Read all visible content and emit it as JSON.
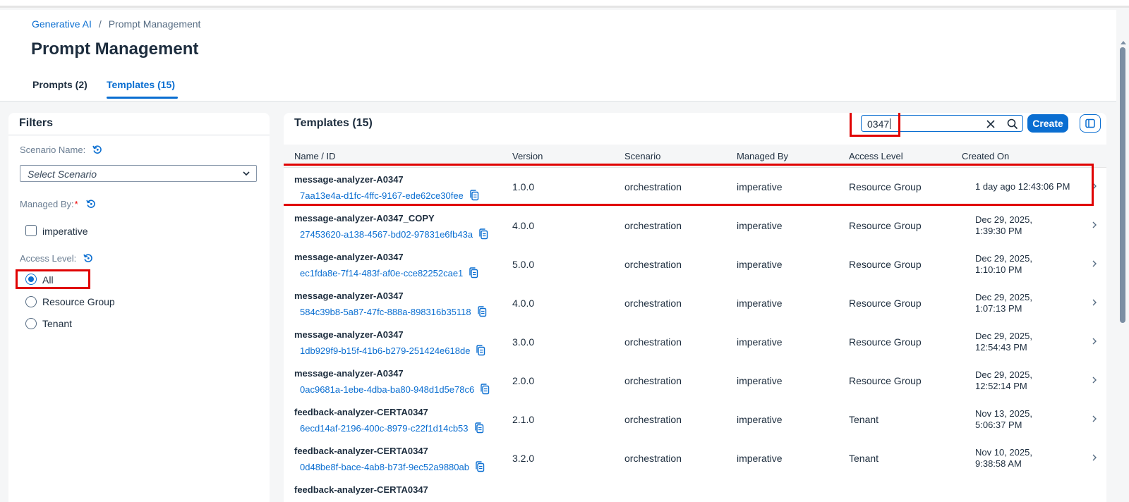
{
  "breadcrumb": {
    "root": "Generative AI",
    "separator": "/",
    "current": "Prompt Management"
  },
  "page_title": "Prompt Management",
  "tabs": [
    {
      "label": "Prompts (2)",
      "active": false
    },
    {
      "label": "Templates (15)",
      "active": true
    }
  ],
  "filters": {
    "title": "Filters",
    "scenario_label": "Scenario Name:",
    "scenario_placeholder": "Select Scenario",
    "managed_label": "Managed By:",
    "managed_required": "*",
    "managed_option": "imperative",
    "access_label": "Access Level:",
    "access_options": [
      "All",
      "Resource Group",
      "Tenant"
    ],
    "access_selected": "All"
  },
  "templates": {
    "title": "Templates (15)",
    "search_value": "0347",
    "create_label": "Create",
    "columns": [
      "Name / ID",
      "Version",
      "Scenario",
      "Managed By",
      "Access Level",
      "Created On"
    ],
    "rows": [
      {
        "name": "message-analyzer-A0347",
        "id": "7aa13e4a-d1fc-4ffc-9167-ede62ce30fee",
        "version": "1.0.0",
        "scenario": "orchestration",
        "managed_by": "imperative",
        "access": "Resource Group",
        "created_1": "1 day ago 12:43:06 PM",
        "created_2": ""
      },
      {
        "name": "message-analyzer-A0347_COPY",
        "id": "27453620-a138-4567-bd02-97831e6fb43a",
        "version": "4.0.0",
        "scenario": "orchestration",
        "managed_by": "imperative",
        "access": "Resource Group",
        "created_1": "Dec 29, 2025,",
        "created_2": "1:39:30 PM"
      },
      {
        "name": "message-analyzer-A0347",
        "id": "ec1fda8e-7f14-483f-af0e-cce82252cae1",
        "version": "5.0.0",
        "scenario": "orchestration",
        "managed_by": "imperative",
        "access": "Resource Group",
        "created_1": "Dec 29, 2025,",
        "created_2": "1:10:10 PM"
      },
      {
        "name": "message-analyzer-A0347",
        "id": "584c39b8-5a87-47fc-888a-898316b35118",
        "version": "4.0.0",
        "scenario": "orchestration",
        "managed_by": "imperative",
        "access": "Resource Group",
        "created_1": "Dec 29, 2025,",
        "created_2": "1:07:13 PM"
      },
      {
        "name": "message-analyzer-A0347",
        "id": "1db929f9-b15f-41b6-b279-251424e618de",
        "version": "3.0.0",
        "scenario": "orchestration",
        "managed_by": "imperative",
        "access": "Resource Group",
        "created_1": "Dec 29, 2025,",
        "created_2": "12:54:43 PM"
      },
      {
        "name": "message-analyzer-A0347",
        "id": "0ac9681a-1ebe-4dba-ba80-948d1d5e78c6",
        "version": "2.0.0",
        "scenario": "orchestration",
        "managed_by": "imperative",
        "access": "Resource Group",
        "created_1": "Dec 29, 2025,",
        "created_2": "12:52:14 PM"
      },
      {
        "name": "feedback-analyzer-CERTA0347",
        "id": "6ecd14af-2196-400c-8979-c22f1d14cb53",
        "version": "2.1.0",
        "scenario": "orchestration",
        "managed_by": "imperative",
        "access": "Tenant",
        "created_1": "Nov 13, 2025,",
        "created_2": "5:06:37 PM"
      },
      {
        "name": "feedback-analyzer-CERTA0347",
        "id": "0d48be8f-bace-4ab8-b73f-9ec52a9880ab",
        "version": "3.2.0",
        "scenario": "orchestration",
        "managed_by": "imperative",
        "access": "Tenant",
        "created_1": "Nov 10, 2025,",
        "created_2": "9:38:58 AM"
      },
      {
        "name": "feedback-analyzer-CERTA0347",
        "id": "",
        "version": "",
        "scenario": "",
        "managed_by": "",
        "access": "",
        "created_1": "",
        "created_2": ""
      }
    ]
  },
  "icons": {
    "reset": "reset-icon",
    "chevron_down": "chevron-down-icon",
    "clear": "close-icon",
    "search": "search-icon",
    "copy": "copy-icon",
    "row_arrow": "chevron-right-icon",
    "panel": "sidebar-toggle-icon"
  },
  "colors": {
    "accent": "#0a6ed1",
    "highlight": "#e00000",
    "text": "#1d2d3e"
  }
}
